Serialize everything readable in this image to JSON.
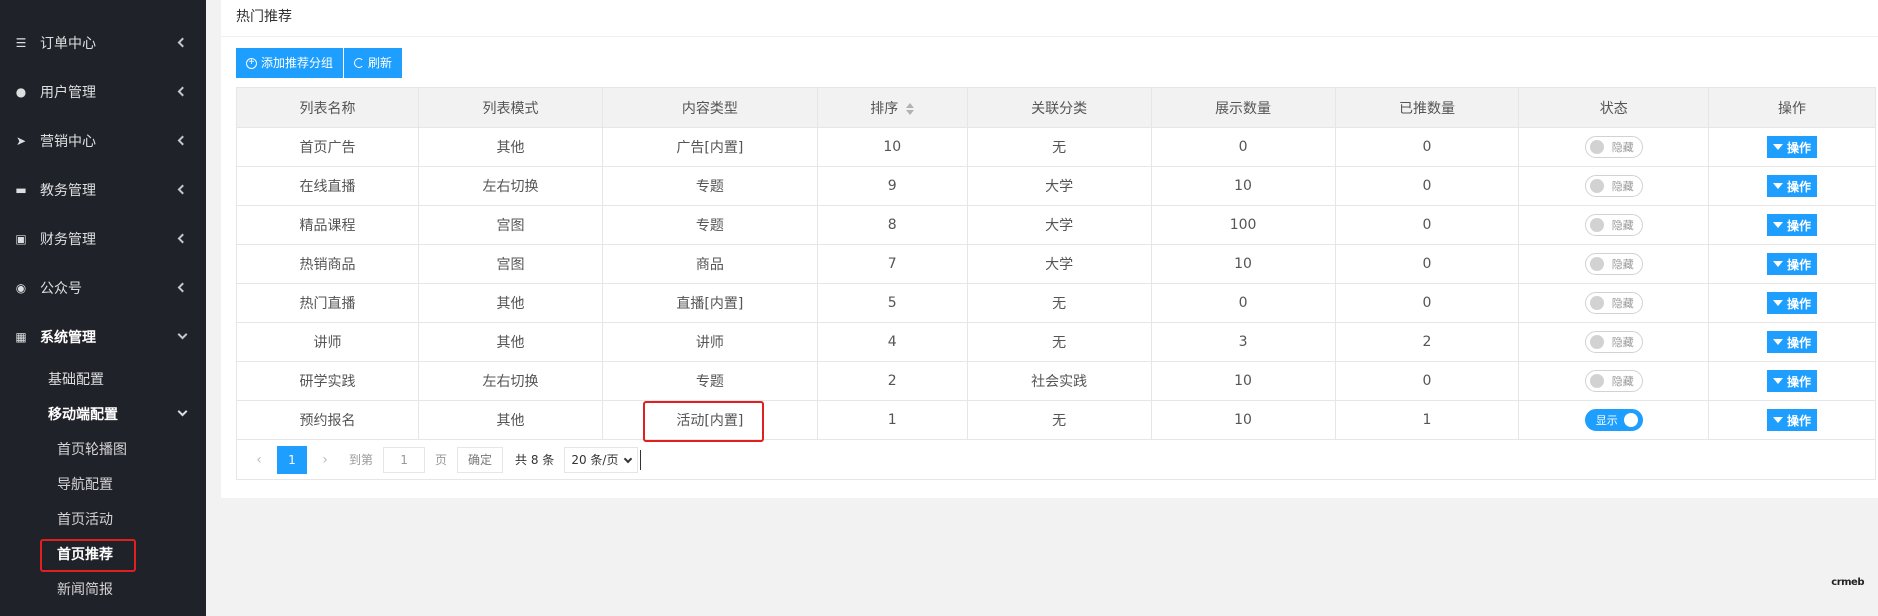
{
  "sidebar": {
    "items": [
      {
        "label": "订单中心",
        "icon": "list-icon"
      },
      {
        "label": "用户管理",
        "icon": "user-icon"
      },
      {
        "label": "营销中心",
        "icon": "send-icon"
      },
      {
        "label": "教务管理",
        "icon": "book-icon"
      },
      {
        "label": "财务管理",
        "icon": "money-icon"
      },
      {
        "label": "公众号",
        "icon": "wechat-icon"
      },
      {
        "label": "系统管理",
        "icon": "grid-icon"
      }
    ],
    "sub": {
      "basic": "基础配置",
      "mobile": "移动端配置"
    },
    "leaves": [
      "首页轮播图",
      "导航配置",
      "首页活动",
      "首页推荐",
      "新闻简报"
    ]
  },
  "card": {
    "title": "热门推荐",
    "add_btn": "添加推荐分组",
    "refresh_btn": "刷新"
  },
  "table": {
    "headers": [
      "列表名称",
      "列表模式",
      "内容类型",
      "排序",
      "关联分类",
      "展示数量",
      "已推数量",
      "状态",
      "操作"
    ],
    "rows": [
      {
        "name": "首页广告",
        "mode": "其他",
        "type": "广告[内置]",
        "sort": "10",
        "cat": "无",
        "show": "0",
        "pushed": "0",
        "status": "隐藏",
        "on": false
      },
      {
        "name": "在线直播",
        "mode": "左右切换",
        "type": "专题",
        "sort": "9",
        "cat": "大学",
        "show": "10",
        "pushed": "0",
        "status": "隐藏",
        "on": false
      },
      {
        "name": "精品课程",
        "mode": "宫图",
        "type": "专题",
        "sort": "8",
        "cat": "大学",
        "show": "100",
        "pushed": "0",
        "status": "隐藏",
        "on": false
      },
      {
        "name": "热销商品",
        "mode": "宫图",
        "type": "商品",
        "sort": "7",
        "cat": "大学",
        "show": "10",
        "pushed": "0",
        "status": "隐藏",
        "on": false
      },
      {
        "name": "热门直播",
        "mode": "其他",
        "type": "直播[内置]",
        "sort": "5",
        "cat": "无",
        "show": "0",
        "pushed": "0",
        "status": "隐藏",
        "on": false
      },
      {
        "name": "讲师",
        "mode": "其他",
        "type": "讲师",
        "sort": "4",
        "cat": "无",
        "show": "3",
        "pushed": "2",
        "status": "隐藏",
        "on": false
      },
      {
        "name": "研学实践",
        "mode": "左右切换",
        "type": "专题",
        "sort": "2",
        "cat": "社会实践",
        "show": "10",
        "pushed": "0",
        "status": "隐藏",
        "on": false
      },
      {
        "name": "预约报名",
        "mode": "其他",
        "type": "活动[内置]",
        "sort": "1",
        "cat": "无",
        "show": "10",
        "pushed": "1",
        "status": "显示",
        "on": true
      }
    ],
    "op_label": "操作"
  },
  "pager": {
    "current": "1",
    "goto_label": "到第",
    "goto_value": "1",
    "page_label": "页",
    "confirm": "确定",
    "total": "共 8 条",
    "per_page": "20 条/页"
  },
  "watermark": "crmeb",
  "colors": {
    "primary": "#1e9fff",
    "sidebar_bg": "#20222a",
    "highlight": "#e02020"
  }
}
